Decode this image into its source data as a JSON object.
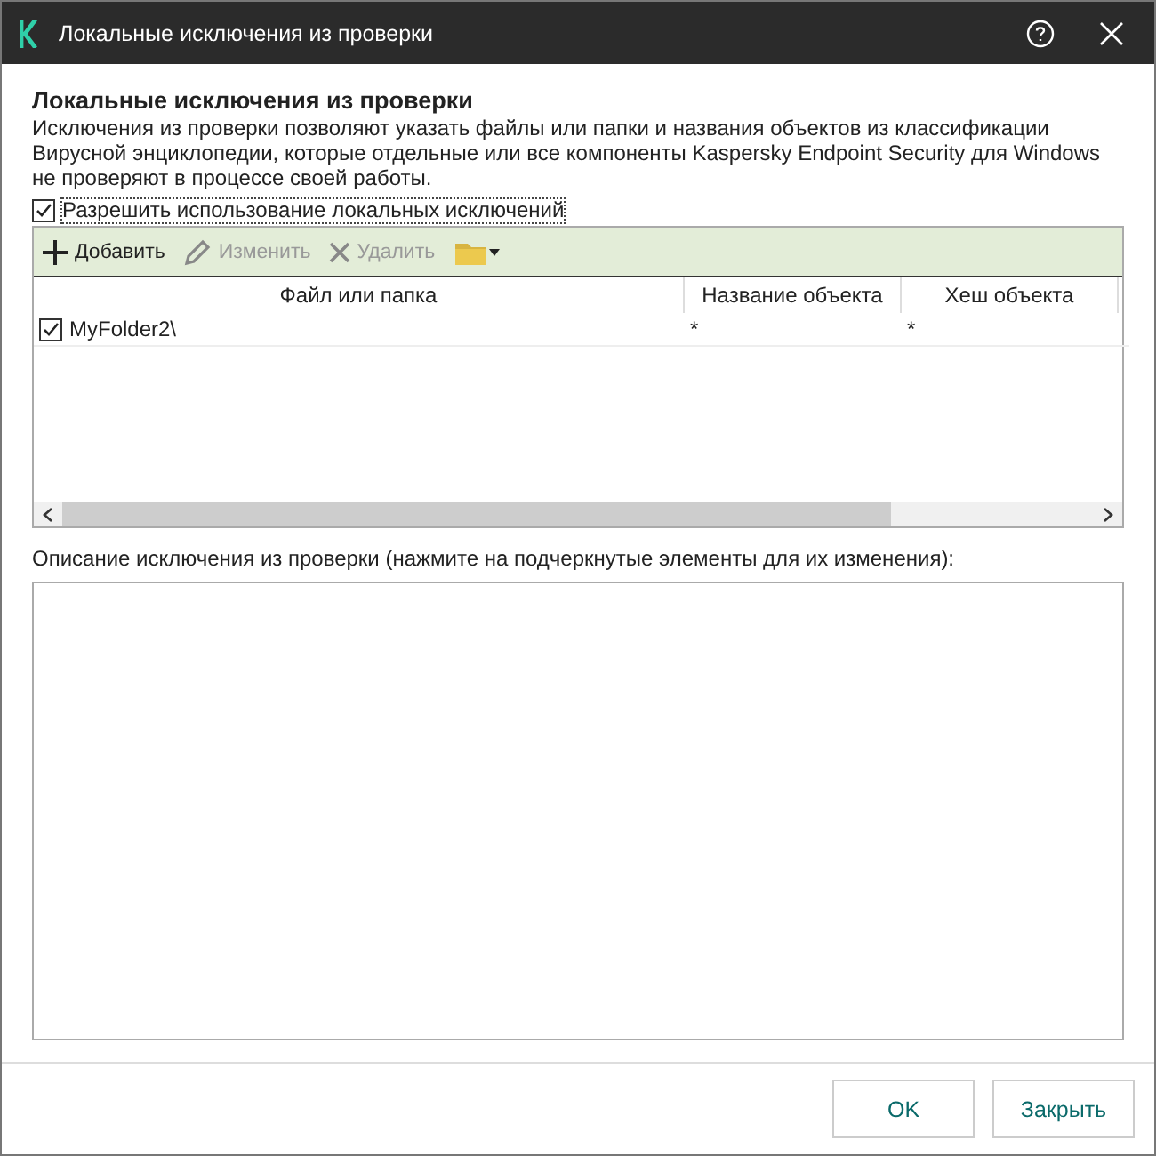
{
  "window": {
    "title": "Локальные исключения из проверки"
  },
  "heading": "Локальные исключения из проверки",
  "description": "Исключения из проверки позволяют указать файлы или папки и названия объектов из классификации Вирусной энциклопедии, которые отдельные или все компоненты Kaspersky Endpoint Security для Windows не проверяют в процессе своей работы.",
  "allow_local": {
    "label": "Разрешить использование локальных исключений",
    "checked": true
  },
  "toolbar": [
    {
      "kind": "add",
      "label": "Добавить",
      "disabled": false
    },
    {
      "kind": "edit",
      "label": "Изменить",
      "disabled": true
    },
    {
      "kind": "delete",
      "label": "Удалить",
      "disabled": true
    },
    {
      "kind": "folder"
    }
  ],
  "table": {
    "columns": [
      "Файл или папка",
      "Название объекта",
      "Хеш объекта"
    ],
    "rows": [
      {
        "checked": true,
        "cells": [
          "MyFolder2\\",
          "*",
          "*"
        ]
      }
    ]
  },
  "details": {
    "label": "Описание исключения из проверки (нажмите на подчеркнутые элементы для их изменения):"
  },
  "buttons": [
    "OK",
    "Закрыть"
  ]
}
